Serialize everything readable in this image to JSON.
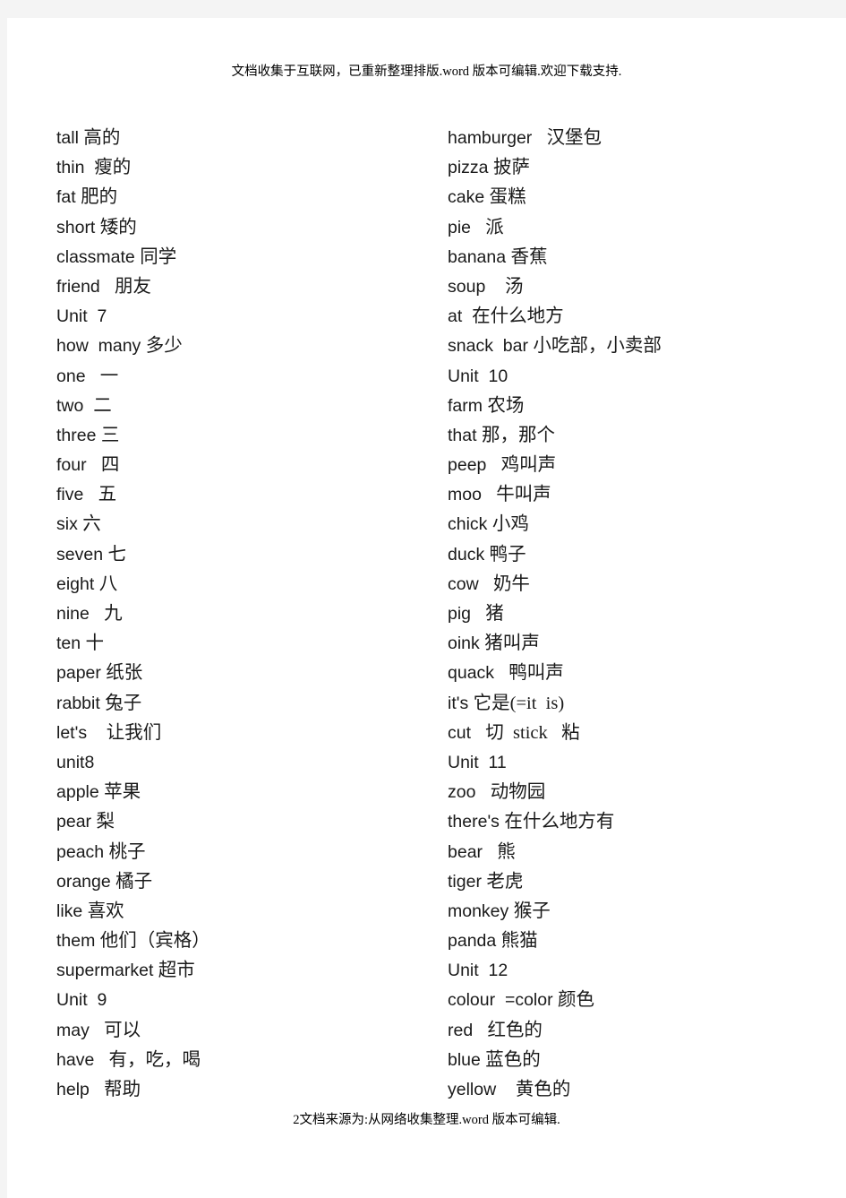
{
  "document": {
    "header_note": "文档收集于互联网，已重新整理排版.word 版本可编辑.欢迎下载支持.",
    "footer_note": "2文档来源为:从网络收集整理.word 版本可编辑.",
    "page_background": "#ffffff",
    "canvas_background": "#f4f4f4",
    "text_color": "#1a1a1a"
  },
  "columns": {
    "left": [
      {
        "en": "tall ",
        "cn": "高的"
      },
      {
        "en": "thin  ",
        "cn": "瘦的"
      },
      {
        "en": "fat ",
        "cn": "肥的"
      },
      {
        "en": "short ",
        "cn": "矮的"
      },
      {
        "en": "classmate ",
        "cn": "同学"
      },
      {
        "en": "friend   ",
        "cn": "朋友"
      },
      {
        "en": "Unit  7",
        "cn": ""
      },
      {
        "en": "how  many ",
        "cn": "多少"
      },
      {
        "en": "one   ",
        "cn": "一"
      },
      {
        "en": "two  ",
        "cn": "二"
      },
      {
        "en": "three ",
        "cn": "三"
      },
      {
        "en": "four   ",
        "cn": "四"
      },
      {
        "en": "five   ",
        "cn": "五"
      },
      {
        "en": "six ",
        "cn": "六"
      },
      {
        "en": "seven ",
        "cn": "七"
      },
      {
        "en": "eight ",
        "cn": "八"
      },
      {
        "en": "nine   ",
        "cn": "九"
      },
      {
        "en": "ten ",
        "cn": "十"
      },
      {
        "en": "paper ",
        "cn": "纸张"
      },
      {
        "en": "rabbit ",
        "cn": "兔子"
      },
      {
        "en": "let's    ",
        "cn": "让我们"
      },
      {
        "en": "unit8",
        "cn": ""
      },
      {
        "en": "apple ",
        "cn": "苹果"
      },
      {
        "en": "pear ",
        "cn": "梨"
      },
      {
        "en": "peach ",
        "cn": "桃子"
      },
      {
        "en": "orange ",
        "cn": "橘子"
      },
      {
        "en": "like ",
        "cn": "喜欢"
      },
      {
        "en": "them ",
        "cn": "他们（宾格）"
      },
      {
        "en": "supermarket ",
        "cn": "超市"
      },
      {
        "en": "Unit  9",
        "cn": ""
      },
      {
        "en": "may   ",
        "cn": "可以"
      },
      {
        "en": "have   ",
        "cn": "有，吃，喝"
      },
      {
        "en": "help   ",
        "cn": "帮助"
      }
    ],
    "right": [
      {
        "en": "hamburger   ",
        "cn": "汉堡包"
      },
      {
        "en": "pizza ",
        "cn": "披萨"
      },
      {
        "en": "cake ",
        "cn": "蛋糕"
      },
      {
        "en": "pie   ",
        "cn": "派"
      },
      {
        "en": "banana ",
        "cn": "香蕉"
      },
      {
        "en": "soup    ",
        "cn": "汤"
      },
      {
        "en": "at  ",
        "cn": "在什么地方"
      },
      {
        "en": "snack  bar ",
        "cn": "小吃部，小卖部"
      },
      {
        "en": "Unit  10",
        "cn": ""
      },
      {
        "en": "farm ",
        "cn": "农场"
      },
      {
        "en": "that ",
        "cn": "那，那个"
      },
      {
        "en": "peep   ",
        "cn": "鸡叫声"
      },
      {
        "en": "moo   ",
        "cn": "牛叫声"
      },
      {
        "en": "chick ",
        "cn": "小鸡"
      },
      {
        "en": "duck ",
        "cn": "鸭子"
      },
      {
        "en": "cow   ",
        "cn": "奶牛"
      },
      {
        "en": "pig   ",
        "cn": "猪"
      },
      {
        "en": "oink ",
        "cn": "猪叫声"
      },
      {
        "en": "quack   ",
        "cn": "鸭叫声"
      },
      {
        "en": "it's ",
        "cn": "它是(=it  is)"
      },
      {
        "en": "cut   ",
        "cn": "切  stick   粘"
      },
      {
        "en": "Unit  11",
        "cn": ""
      },
      {
        "en": "zoo   ",
        "cn": "动物园"
      },
      {
        "en": "there's ",
        "cn": "在什么地方有"
      },
      {
        "en": "bear   ",
        "cn": "熊"
      },
      {
        "en": "tiger ",
        "cn": "老虎"
      },
      {
        "en": "monkey ",
        "cn": "猴子"
      },
      {
        "en": "panda ",
        "cn": "熊猫"
      },
      {
        "en": "Unit  12",
        "cn": ""
      },
      {
        "en": "colour  =color ",
        "cn": "颜色"
      },
      {
        "en": "red   ",
        "cn": "红色的"
      },
      {
        "en": "blue ",
        "cn": "蓝色的"
      },
      {
        "en": "yellow    ",
        "cn": "黄色的"
      }
    ]
  }
}
